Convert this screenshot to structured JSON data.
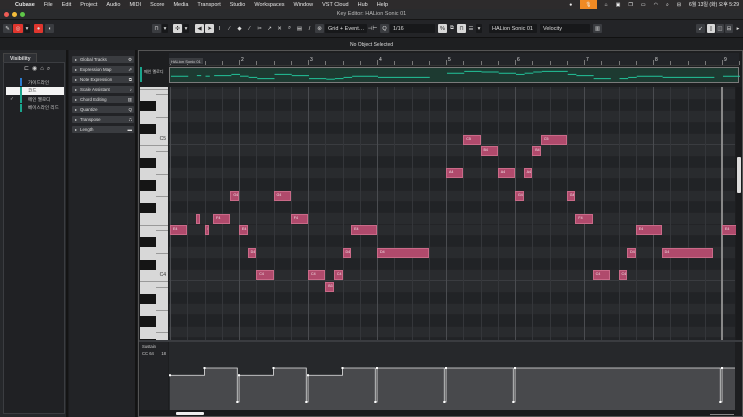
{
  "menubar": {
    "apple": "",
    "app": "Cubase",
    "items": [
      "File",
      "Edit",
      "Project",
      "Audio",
      "MIDI",
      "Score",
      "Media",
      "Transport",
      "Studio",
      "Workspaces",
      "Window",
      "VST Cloud",
      "Hub",
      "Help"
    ],
    "clock": "6월 13일 (화) 오후 5:29",
    "icons": [
      "chat-icon",
      "mic-icon",
      "airplay-icon",
      "display-icon",
      "window-icon",
      "battery-icon",
      "wifi-icon",
      "search-icon",
      "control-center-icon"
    ]
  },
  "window": {
    "title": "Key Editor: HALion Sonic 01"
  },
  "toolbar": {
    "grid_type": "Grid + Event…",
    "quantize": "1/16",
    "track": "HALion Sonic 01",
    "controller": "Velocity",
    "tools": [
      "pointer",
      "range",
      "draw",
      "erase",
      "trim",
      "split",
      "glue",
      "mute",
      "zoom",
      "line",
      "drum"
    ]
  },
  "info": {
    "status": "No Object Selected"
  },
  "visibility": {
    "tab": "Visibility",
    "tracks": [
      {
        "name": "가이드라인",
        "selected": false,
        "color": "#2a7bd0",
        "checked": ""
      },
      {
        "name": "코드",
        "selected": true,
        "color": "#1aa58d",
        "checked": ""
      },
      {
        "name": "메인 멜로디",
        "selected": false,
        "color": "#1aa58d",
        "checked": "✓"
      },
      {
        "name": "베이스라인 리드",
        "selected": false,
        "color": "#1aa58d",
        "checked": ""
      }
    ]
  },
  "inspector": {
    "sections": [
      {
        "label": "Global Tracks",
        "icon": "⚙"
      },
      {
        "label": "Expression Map",
        "icon": "⇗"
      },
      {
        "label": "Note Expression",
        "icon": "⧉"
      },
      {
        "label": "Scale Assistant",
        "icon": "♪"
      },
      {
        "label": "Chord Editing",
        "icon": "▥"
      },
      {
        "label": "Quantize",
        "icon": "Q"
      },
      {
        "label": "Transpose",
        "icon": "⎍"
      },
      {
        "label": "Length",
        "icon": "▬"
      }
    ]
  },
  "editor": {
    "part_name": "HALion Sonic 01",
    "track_name": "메인 멜로디",
    "bars": [
      "2",
      "3",
      "4",
      "5",
      "6",
      "7",
      "8",
      "9"
    ],
    "key_labels": {
      "c5": "C5",
      "c4": "C4"
    },
    "lane": {
      "name": "Sustain",
      "cc": "CC 64",
      "value": "18"
    }
  },
  "chart_data": {
    "type": "piano-roll",
    "beats_per_bar": 4,
    "notes": [
      {
        "pitch": "E4",
        "midi": 64,
        "start": 0,
        "len": 1
      },
      {
        "pitch": "F4",
        "midi": 65,
        "start": 1.5,
        "len": 0.25
      },
      {
        "pitch": "E4",
        "midi": 64,
        "start": 2,
        "len": 0.25
      },
      {
        "pitch": "F4",
        "midi": 65,
        "start": 2.5,
        "len": 1
      },
      {
        "pitch": "G4",
        "midi": 67,
        "start": 3.5,
        "len": 0.5
      },
      {
        "pitch": "E4",
        "midi": 64,
        "start": 4,
        "len": 0.5
      },
      {
        "pitch": "D4",
        "midi": 62,
        "start": 4.5,
        "len": 0.5
      },
      {
        "pitch": "C4",
        "midi": 60,
        "start": 5,
        "len": 1
      },
      {
        "pitch": "G4",
        "midi": 67,
        "start": 6,
        "len": 1
      },
      {
        "pitch": "F4",
        "midi": 65,
        "start": 7,
        "len": 1
      },
      {
        "pitch": "C4",
        "midi": 60,
        "start": 8,
        "len": 1
      },
      {
        "pitch": "B3",
        "midi": 59,
        "start": 9,
        "len": 0.5
      },
      {
        "pitch": "C4",
        "midi": 60,
        "start": 9.5,
        "len": 0.5
      },
      {
        "pitch": "D4",
        "midi": 62,
        "start": 10,
        "len": 0.5
      },
      {
        "pitch": "E4",
        "midi": 64,
        "start": 10.5,
        "len": 1.5
      },
      {
        "pitch": "D4",
        "midi": 62,
        "start": 12,
        "len": 3
      },
      {
        "pitch": "A4",
        "midi": 69,
        "start": 16,
        "len": 1
      },
      {
        "pitch": "C5",
        "midi": 72,
        "start": 17,
        "len": 1
      },
      {
        "pitch": "B4",
        "midi": 71,
        "start": 18,
        "len": 1
      },
      {
        "pitch": "A4",
        "midi": 69,
        "start": 19,
        "len": 1
      },
      {
        "pitch": "G4",
        "midi": 67,
        "start": 20,
        "len": 0.5
      },
      {
        "pitch": "A4",
        "midi": 69,
        "start": 20.5,
        "len": 0.5
      },
      {
        "pitch": "B4",
        "midi": 71,
        "start": 21,
        "len": 0.5
      },
      {
        "pitch": "C5",
        "midi": 72,
        "start": 21.5,
        "len": 1.5
      },
      {
        "pitch": "G4",
        "midi": 67,
        "start": 23,
        "len": 0.5
      },
      {
        "pitch": "F4",
        "midi": 65,
        "start": 23.5,
        "len": 1
      },
      {
        "pitch": "C4",
        "midi": 60,
        "start": 24.5,
        "len": 1
      },
      {
        "pitch": "C4",
        "midi": 60,
        "start": 26,
        "len": 0.5
      },
      {
        "pitch": "D4",
        "midi": 62,
        "start": 26.5,
        "len": 0.5
      },
      {
        "pitch": "E4",
        "midi": 64,
        "start": 27,
        "len": 1.5
      },
      {
        "pitch": "D4",
        "midi": 62,
        "start": 28.5,
        "len": 3
      },
      {
        "pitch": "E4",
        "midi": 64,
        "start": 32,
        "len": 1
      }
    ],
    "sustain": [
      {
        "beat": 0,
        "value": 100
      },
      {
        "beat": 2,
        "value": 127
      },
      {
        "beat": 3.9,
        "value": 0
      },
      {
        "beat": 4,
        "value": 100
      },
      {
        "beat": 6,
        "value": 127
      },
      {
        "beat": 7.9,
        "value": 0
      },
      {
        "beat": 8,
        "value": 100
      },
      {
        "beat": 10,
        "value": 127
      },
      {
        "beat": 11.9,
        "value": 0
      },
      {
        "beat": 12,
        "value": 127
      },
      {
        "beat": 15.9,
        "value": 0
      },
      {
        "beat": 16,
        "value": 127
      },
      {
        "beat": 19.9,
        "value": 0
      },
      {
        "beat": 20,
        "value": 127
      },
      {
        "beat": 31.9,
        "value": 0
      },
      {
        "beat": 32,
        "value": 127
      }
    ]
  },
  "colors": {
    "note": "#b04a6c",
    "accent": "#1aa58d",
    "record": "#e0362e"
  }
}
